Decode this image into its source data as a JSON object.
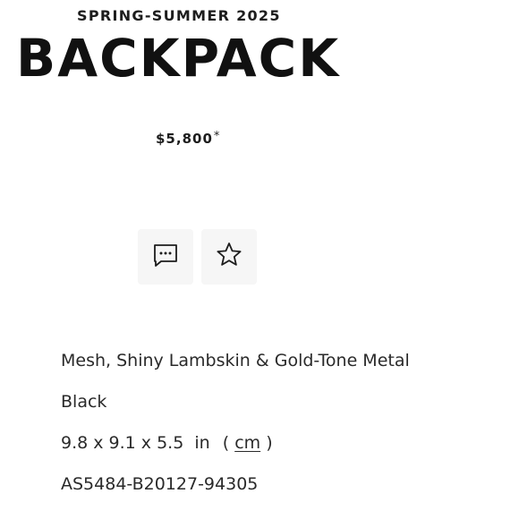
{
  "product": {
    "collection": "SPRING-SUMMER 2025",
    "name": "BACKPACK",
    "price": "$5,800",
    "price_note": "*"
  },
  "actions": {
    "contact_icon": "chat-bubble-ellipsis-icon",
    "wishlist_icon": "star-outline-icon"
  },
  "details": {
    "material": "Mesh, Shiny Lambskin & Gold-Tone Metal",
    "color": "Black",
    "dimensions": "9.8 x 9.1 x 5.5",
    "unit_in": "in",
    "unit_open": "(",
    "unit_cm": "cm",
    "unit_close": ")",
    "reference": "AS5484-B20127-94305"
  }
}
